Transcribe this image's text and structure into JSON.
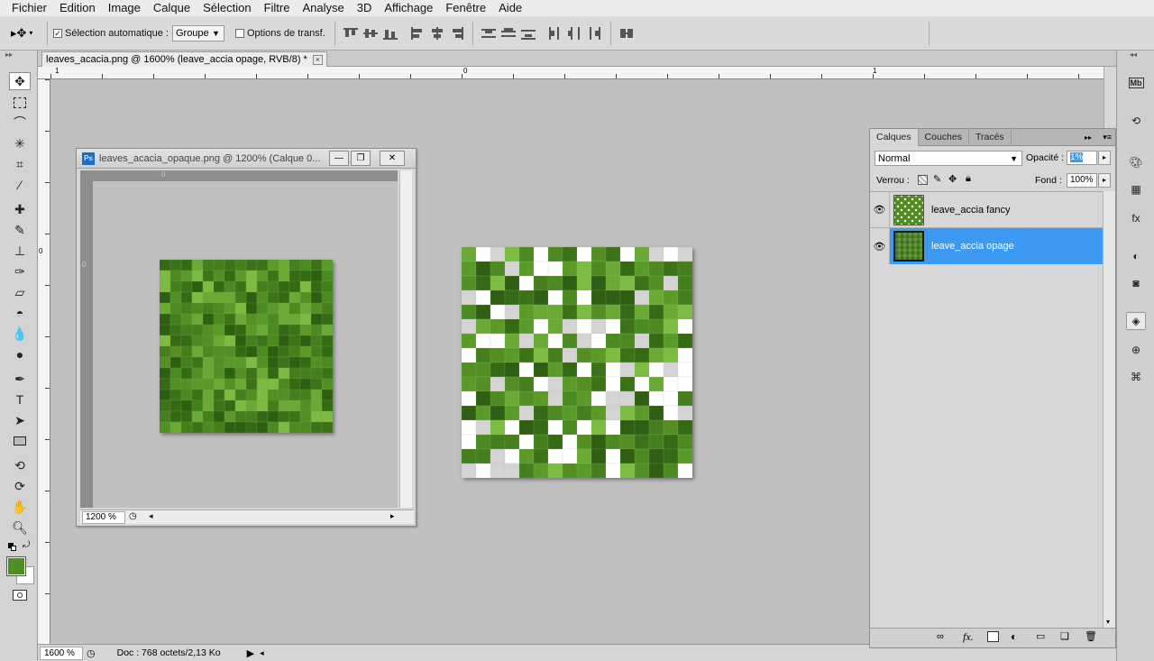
{
  "menu": [
    "Fichier",
    "Edition",
    "Image",
    "Calque",
    "Sélection",
    "Filtre",
    "Analyse",
    "3D",
    "Affichage",
    "Fenêtre",
    "Aide"
  ],
  "options": {
    "auto_select_label": "Sélection automatique :",
    "auto_select_checked": "✓",
    "auto_select_value": "Groupe",
    "transform_label": "Options de transf."
  },
  "document_tab": {
    "title": "leaves_acacia.png @ 1600% (leave_accia opage, RVB/8) *",
    "close": "×"
  },
  "ruler": {
    "top_labels": [
      "1",
      "0",
      "1"
    ],
    "left_label": "0"
  },
  "float_window": {
    "title": "leaves_acacia_opaque.png @ 1200% (Calque 0...",
    "ps_badge": "Ps",
    "ruler_top": "0",
    "ruler_left": "0",
    "zoom": "1200 %"
  },
  "status": {
    "zoom": "1600 %",
    "doc": "Doc : 768 octets/2,13 Ko"
  },
  "layers_panel": {
    "tabs": [
      "Calques",
      "Couches",
      "Tracés"
    ],
    "blend_mode": "Normal",
    "opacity_label": "Opacité :",
    "opacity_value": "1%",
    "lock_label": "Verrou :",
    "fill_label": "Fond :",
    "fill_value": "100%",
    "layers": [
      {
        "name": "leave_accia fancy",
        "selected": false
      },
      {
        "name": "leave_accia opage",
        "selected": true
      }
    ]
  },
  "colors": {
    "foreground": "#4d8f23",
    "background": "#ffffff",
    "selection": "#3d9af2"
  }
}
